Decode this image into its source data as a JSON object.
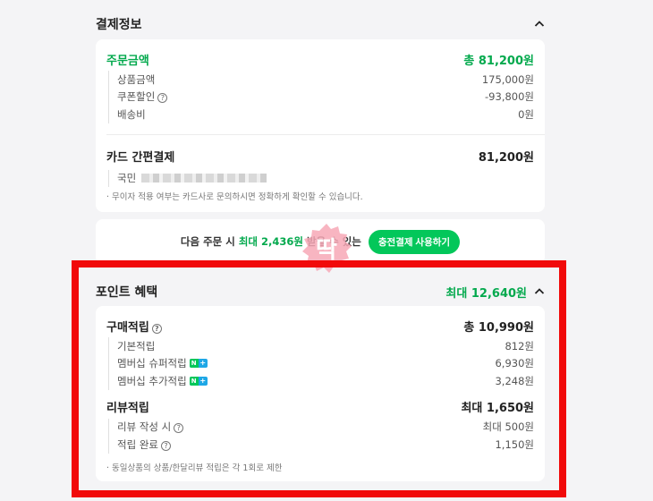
{
  "payment": {
    "title": "결제정보",
    "order_label": "주문금액",
    "order_total": "총 81,200원",
    "items": [
      {
        "label": "상품금액",
        "value": "175,000원"
      },
      {
        "label": "쿠폰할인",
        "value": "-93,800원"
      },
      {
        "label": "배송비",
        "value": "0원"
      }
    ],
    "card_label": "카드 간편결제",
    "card_amount": "81,200원",
    "card_name": "국민",
    "note": "· 무이자 적용 여부는 카드사로 문의하시면 정확하게 확인할 수 있습니다."
  },
  "promo": {
    "prefix": "다음 주문 시 ",
    "highlight": "최대 2,436원",
    "suffix": " 받을 수 있는",
    "button": "충전결제 사용하기"
  },
  "points": {
    "title": "포인트 혜택",
    "max": "최대 12,640원",
    "purchase": {
      "label": "구매적립",
      "total": "총 10,990원",
      "items": [
        {
          "label": "기본적립",
          "value": "812원"
        },
        {
          "label": "멤버십 슈퍼적립",
          "value": "6,930원"
        },
        {
          "label": "멤버십 추가적립",
          "value": "3,248원"
        }
      ]
    },
    "review": {
      "label": "리뷰적립",
      "total": "최대 1,650원",
      "items": [
        {
          "label": "리뷰 작성 시",
          "value": "최대 500원"
        },
        {
          "label": "적립 완료",
          "value": "1,150원"
        }
      ]
    },
    "note": "· 동일상품의 상품/한달리뷰 적립은 각 1회로 제한"
  },
  "colors": {
    "accent_green": "#03a94d",
    "button_green": "#03c75a",
    "highlight_red": "#f10a0a"
  }
}
